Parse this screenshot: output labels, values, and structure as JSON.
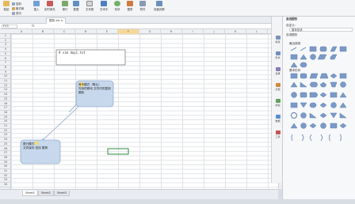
{
  "toolbar": {
    "buttons": [
      "粘贴",
      "复制",
      "格式刷",
      "插入",
      "实时填充",
      "换行",
      "数据",
      "文本框",
      "艺术字",
      "形状",
      "图表",
      "附件",
      "页眉页脚"
    ],
    "small_buttons": [
      "剪切",
      "新建",
      "排序",
      "筛选",
      "合并",
      "求和",
      "条件"
    ]
  },
  "tabs": {
    "active": "图形.xls"
  },
  "formula_bar": {
    "namebox": "F23",
    "fx": "fx"
  },
  "columns": [
    "A",
    "B",
    "C",
    "D",
    "E",
    "F",
    "G",
    "H",
    "I",
    "J",
    "K",
    "L"
  ],
  "selected_column": "F",
  "rows": [
    "1",
    "2",
    "3",
    "4",
    "5",
    "6",
    "7",
    "8",
    "9",
    "10",
    "11",
    "12",
    "13",
    "14",
    "15",
    "16",
    "17",
    "18",
    "19",
    "20",
    "21",
    "22",
    "23",
    "24",
    "25",
    "26",
    "27",
    "28",
    "29",
    "30",
    "31",
    "32",
    "33",
    "34"
  ],
  "shapes": {
    "box1_text": "# vim day1.txt",
    "box2_line1": "命令模式（默认）",
    "box2_line2": "光标的移动 文件内的复制 删除",
    "box3_line1": "尾行模式",
    "box3_line2": "文件保存 查找 替换"
  },
  "sheets": [
    "Sheet1",
    "Sheet2",
    "Sheet3"
  ],
  "active_sheet": "Sheet1",
  "right_tools": [
    "新建",
    "形状",
    "选择",
    "文档",
    "剪贴",
    "数据",
    "工具"
  ],
  "panel": {
    "title": "自选图形",
    "label1": "自定义:",
    "select1": "基本形状",
    "label2": "自选图形",
    "label3": "最近使用",
    "label4": "基本形状"
  },
  "colors": {
    "shape_fill": "#c7d8ec",
    "shape_border": "#7896c1",
    "accent": "#f5d76e",
    "selected_cell": "#2e8b3e"
  }
}
